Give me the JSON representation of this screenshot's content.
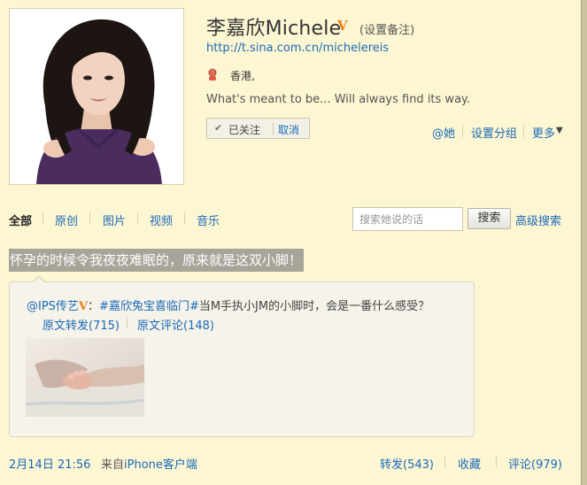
{
  "profile": {
    "name": "李嘉欣Michele",
    "verified_mark": "V",
    "set_remark": "(设置备注)",
    "url": "http://t.sina.com.cn/michelereis",
    "location": "香港,",
    "bio": "What's meant to be... Will always find its way.",
    "follow_status": "已关注",
    "cancel_follow": "取消",
    "actions": {
      "at": "@她",
      "set_group": "设置分组",
      "more": "更多"
    }
  },
  "tabs": [
    {
      "label": "全部"
    },
    {
      "label": "原创"
    },
    {
      "label": "图片"
    },
    {
      "label": "视频"
    },
    {
      "label": "音乐"
    }
  ],
  "search": {
    "placeholder": "搜索她说的话",
    "button_label": "搜索",
    "advanced_label": "高级搜索"
  },
  "post": {
    "text": "怀孕的时候令我夜夜难眠的，原来就是这双小脚！",
    "repost": {
      "author": "@IPS传艺",
      "verified_mark": "V",
      "separator": "：",
      "topic": "#嘉欣兔宝喜临门#",
      "content": "当M手执小JM的小脚时，会是一番什么感受？",
      "orig_repost_label": "原文转发(715)",
      "orig_comment_label": "原文评论(148)"
    },
    "time": "2月14日 21:56",
    "from_prefix": "来自",
    "client": "iPhone客户端",
    "repost_label": "转发(543)",
    "favorite_label": "收藏",
    "comment_label": "评论(979)"
  },
  "icons": {
    "gender": "female-user-icon",
    "check": "check-icon",
    "dropdown": "chevron-down-icon"
  },
  "colors": {
    "page_background": "#fdf6d3",
    "link": "#1a6ab8",
    "verified": "#e87e10",
    "highlight": "#a9a49a"
  }
}
